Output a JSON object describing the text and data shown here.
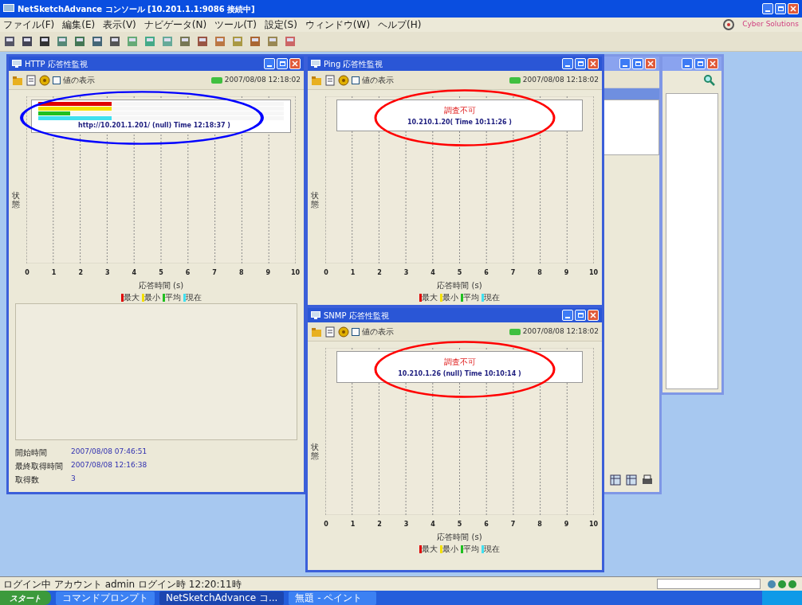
{
  "window": {
    "title": "NetSketchAdvance コンソール [10.201.1.1:9086 接続中]"
  },
  "menu": [
    "ファイル(F)",
    "編集(E)",
    "表示(V)",
    "ナビゲータ(N)",
    "ツール(T)",
    "設定(S)",
    "ウィンドウ(W)",
    "ヘルプ(H)"
  ],
  "branding": "Cyber Solutions",
  "monitors": [
    {
      "title": "HTTP 応答性監視",
      "show_values_label": "値の表示",
      "show_values": false,
      "timestamp": "2007/08/08 12:18:02",
      "color": "#0000ff",
      "legend": {
        "kind": "bars",
        "bars": [
          {
            "color": "#e00000",
            "level": 0.3
          },
          {
            "color": "#f4e000",
            "level": 0.3
          },
          {
            "color": "#20c020",
            "level": 0.13
          },
          {
            "color": "#40e0f0",
            "level": 0.3
          }
        ],
        "caption": "http://10.201.1.201/ (null) Time 12:18:37 )"
      },
      "ylabel": "状態",
      "xticks": [
        "0",
        "1",
        "2",
        "3",
        "4",
        "5",
        "6",
        "7",
        "8",
        "9",
        "10"
      ],
      "xlabel": "応答時間 (s)",
      "series": [
        {
          "label": "最大",
          "color": "#e00000"
        },
        {
          "label": "最小",
          "color": "#f4e000"
        },
        {
          "label": "平均",
          "color": "#20c020"
        },
        {
          "label": "現在",
          "color": "#40e0f0"
        }
      ],
      "info": [
        {
          "label": "開始時間",
          "value": "2007/08/08 07:46:51"
        },
        {
          "label": "最終取得時間",
          "value": "2007/08/08 12:16:38"
        },
        {
          "label": "取得数",
          "value": "3"
        }
      ]
    },
    {
      "title": "Ping 応答性監視",
      "show_values_label": "値の表示",
      "show_values": false,
      "timestamp": "2007/08/08 12:18:02",
      "color": "#ff0000",
      "legend": {
        "kind": "message",
        "message": "調査不可",
        "caption": "10.210.1.20( Time 10:11:26 )"
      },
      "ylabel": "状態",
      "xticks": [
        "0",
        "1",
        "2",
        "3",
        "4",
        "5",
        "6",
        "7",
        "8",
        "9",
        "10"
      ],
      "xlabel": "応答時間 (s)",
      "series": [
        {
          "label": "最大",
          "color": "#e00000"
        },
        {
          "label": "最小",
          "color": "#f4e000"
        },
        {
          "label": "平均",
          "color": "#20c020"
        },
        {
          "label": "現在",
          "color": "#40e0f0"
        }
      ]
    },
    {
      "title": "SNMP 応答性監視",
      "show_values_label": "値の表示",
      "show_values": false,
      "timestamp": "2007/08/08 12:18:02",
      "color": "#ff0000",
      "legend": {
        "kind": "message",
        "message": "調査不可",
        "caption": "10.210.1.26 (null) Time 10:10:14 )"
      },
      "ylabel": "状態",
      "xticks": [
        "0",
        "1",
        "2",
        "3",
        "4",
        "5",
        "6",
        "7",
        "8",
        "9",
        "10"
      ],
      "xlabel": "応答時間 (s)",
      "series": [
        {
          "label": "最大",
          "color": "#e00000"
        },
        {
          "label": "最小",
          "color": "#f4e000"
        },
        {
          "label": "平均",
          "color": "#20c020"
        },
        {
          "label": "現在",
          "color": "#40e0f0"
        }
      ]
    }
  ],
  "status_bar": "ログイン中 アカウント admin ログイン時 12:20:11時",
  "taskbar": {
    "start": "スタート",
    "items": [
      {
        "label": "コマンドプロンプト",
        "selected": false
      },
      {
        "label": "NetSketchAdvance コ...",
        "selected": true
      },
      {
        "label": "無題 - ペイント",
        "selected": false
      }
    ]
  }
}
